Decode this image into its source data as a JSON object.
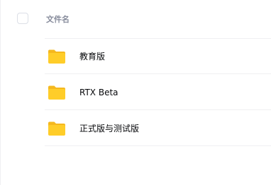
{
  "file_list": {
    "header": {
      "column_title": "文件名"
    },
    "items": [
      {
        "name": "教育版",
        "icon": "folder-icon"
      },
      {
        "name": "RTX Beta",
        "icon": "folder-icon"
      },
      {
        "name": "正式版与测试版",
        "icon": "folder-icon"
      }
    ]
  },
  "colors": {
    "folder_body": "#FFCD29",
    "folder_tab": "#F5B81E",
    "text": "#06070A",
    "header_text": "#878C9C",
    "divider": "#EFF0F2"
  }
}
